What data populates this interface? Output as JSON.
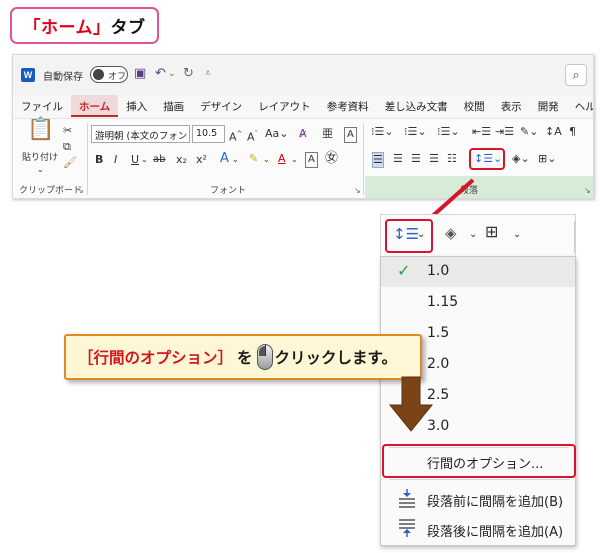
{
  "title": {
    "open": "「",
    "main": "ホーム",
    "close": "」",
    "suffix": "タブ"
  },
  "qat": {
    "app_icon": "W",
    "autosave_label": "自動保存",
    "autosave_state": "オフ",
    "icons": [
      "save-icon",
      "undo-icon",
      "redo-icon",
      "customize-icon"
    ],
    "search_icon": "search-icon"
  },
  "tabs": [
    "ファイル",
    "ホーム",
    "挿入",
    "描画",
    "デザイン",
    "レイアウト",
    "参考資料",
    "差し込み文書",
    "校閲",
    "表示",
    "開発",
    "ヘルプ"
  ],
  "active_tab": "ホーム",
  "groups": {
    "clipboard": {
      "label": "クリップボード",
      "paste": "貼り付け"
    },
    "font": {
      "label": "フォント",
      "font_name": "游明朝 (本文のフォント",
      "font_size": "10.5",
      "bold": "B",
      "italic": "I",
      "underline": "U",
      "strike": "ab",
      "sub": "x₂",
      "sup": "x²"
    },
    "paragraph": {
      "label": "段落"
    }
  },
  "dropdown": {
    "spacing_options": [
      "1.0",
      "1.15",
      "1.5",
      "2.0",
      "2.5",
      "3.0"
    ],
    "selected": "1.0",
    "commands": [
      {
        "label": "行間のオプション..."
      },
      {
        "label": "段落前に間隔を追加(B)"
      },
      {
        "label": "段落後に間隔を追加(A)"
      }
    ]
  },
  "callout": {
    "highlight": "［行間のオプション］",
    "mid": "を",
    "action": "クリックします。"
  },
  "colors": {
    "accent_red": "#d6152a",
    "title_border": "#e0529a",
    "callout_border": "#e18a23",
    "paragraph_group": "#d6ecd8"
  }
}
